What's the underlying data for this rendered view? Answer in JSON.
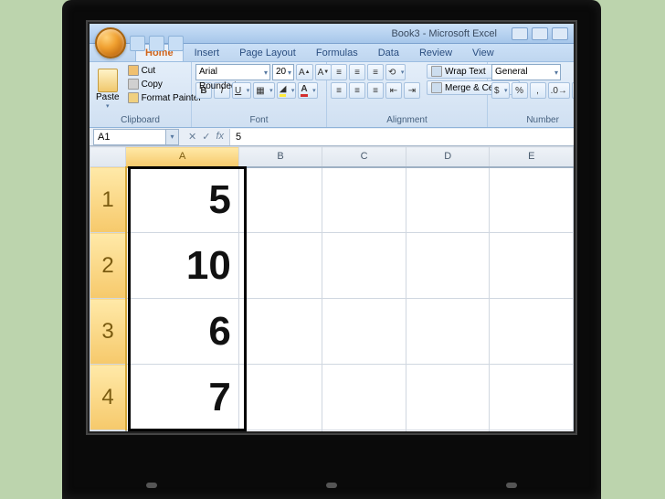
{
  "title": "Book3 - Microsoft Excel",
  "qat": {
    "save": "Save",
    "undo": "Undo",
    "redo": "Redo"
  },
  "tabs": {
    "home": "Home",
    "insert": "Insert",
    "page_layout": "Page Layout",
    "formulas": "Formulas",
    "data": "Data",
    "review": "Review",
    "view": "View"
  },
  "clipboard": {
    "paste": "Paste",
    "cut": "Cut",
    "copy": "Copy",
    "format_painter": "Format Painter",
    "group_label": "Clipboard"
  },
  "font": {
    "name": "Arial Rounded M",
    "size": "20",
    "bold": "B",
    "italic": "I",
    "underline": "U",
    "group_label": "Font"
  },
  "alignment": {
    "wrap_text": "Wrap Text",
    "merge_center": "Merge & Center",
    "group_label": "Alignment"
  },
  "number": {
    "format": "General",
    "group_label": "Number"
  },
  "namebox": "A1",
  "formula_value": "5",
  "columns": [
    "A",
    "B",
    "C",
    "D",
    "E"
  ],
  "rows": [
    "1",
    "2",
    "3",
    "4"
  ],
  "cells": {
    "A1": "5",
    "A2": "10",
    "A3": "6",
    "A4": "7"
  },
  "chart_data": {
    "type": "table",
    "columns": [
      "A"
    ],
    "rows": [
      [
        5
      ],
      [
        10
      ],
      [
        6
      ],
      [
        7
      ]
    ]
  }
}
